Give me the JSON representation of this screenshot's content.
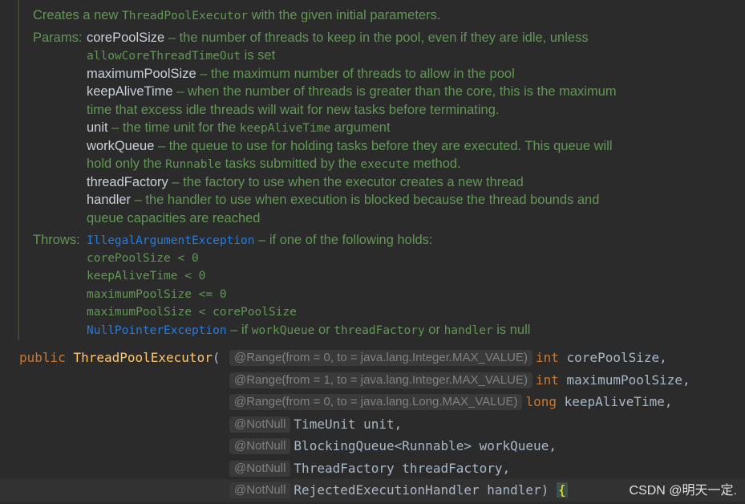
{
  "doc": {
    "summary_pre": "Creates a new ",
    "summary_code": "ThreadPoolExecutor",
    "summary_post": " with the given initial parameters.",
    "params_label": "Params:",
    "params": [
      {
        "name": "corePoolSize",
        "desc": " – the number of threads to keep in the pool, even if they are idle, unless"
      },
      {
        "cont_code": "allowCoreThreadTimeOut",
        "cont_post": " is set"
      },
      {
        "name": "maximumPoolSize",
        "desc": " – the maximum number of threads to allow in the pool"
      },
      {
        "name": "keepAliveTime",
        "desc": " – when the number of threads is greater than the core, this is the maximum"
      },
      {
        "cont": "time that excess idle threads will wait for new tasks before terminating."
      },
      {
        "name": "unit",
        "desc": " – the time unit for the ",
        "code": "keepAliveTime",
        "post": " argument"
      },
      {
        "name": "workQueue",
        "desc": " – the queue to use for holding tasks before they are executed. This queue will"
      },
      {
        "cont_pre": "hold only the ",
        "cont_code": "Runnable",
        "cont_mid": " tasks submitted by the ",
        "cont_code2": "execute",
        "cont_post": " method."
      },
      {
        "name": "threadFactory",
        "desc": " – the factory to use when the executor creates a new thread"
      },
      {
        "name": "handler",
        "desc": " – the handler to use when execution is blocked because the thread bounds and"
      },
      {
        "cont": "queue capacities are reached"
      }
    ],
    "throws_label": "Throws:",
    "throws": {
      "ex1": "IllegalArgumentException",
      "ex1_desc": " – if one of the following holds:",
      "conds": [
        "corePoolSize < 0",
        "keepAliveTime < 0",
        "maximumPoolSize <= 0",
        "maximumPoolSize < corePoolSize"
      ],
      "ex2": "NullPointerException",
      "ex2_pre": " – if ",
      "ex2_a": "workQueue",
      "ex2_or1": " or ",
      "ex2_b": "threadFactory",
      "ex2_or2": " or ",
      "ex2_c": "handler",
      "ex2_post": " is null"
    }
  },
  "code": {
    "kw_public": "public",
    "ctor": "ThreadPoolExecutor",
    "open_paren": "(",
    "lines": [
      {
        "ann": "@Range(from = 0, to = java.lang.Integer.MAX_VALUE)",
        "type": "int",
        "name": "corePoolSize",
        "tail": ","
      },
      {
        "ann": "@Range(from = 1, to = java.lang.Integer.MAX_VALUE)",
        "type": "int",
        "name": "maximumPoolSize",
        "tail": ","
      },
      {
        "ann": "@Range(from = 0, to = java.lang.Long.MAX_VALUE)",
        "type": "long",
        "name": "keepAliveTime",
        "tail": ","
      },
      {
        "ann": "@NotNull",
        "type": "TimeUnit",
        "name": "unit",
        "tail": ","
      },
      {
        "ann": "@NotNull",
        "type": "BlockingQueue<Runnable>",
        "name": "workQueue",
        "tail": ","
      },
      {
        "ann": "@NotNull",
        "type": "ThreadFactory",
        "name": "threadFactory",
        "tail": ","
      },
      {
        "ann": "@NotNull",
        "type": "RejectedExecutionHandler",
        "name": "handler",
        "tail": ") ",
        "brace": "{"
      }
    ]
  },
  "watermark": "CSDN @明天一定."
}
